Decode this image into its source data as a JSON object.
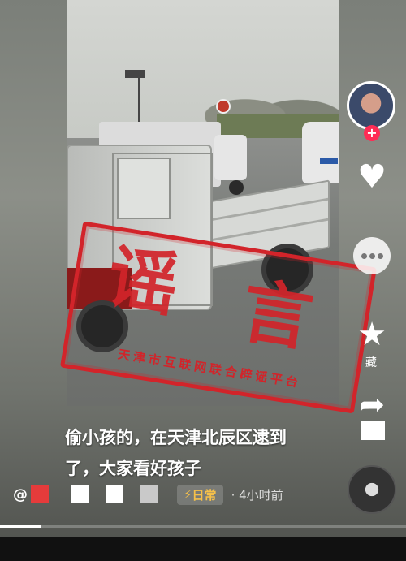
{
  "video": {
    "stamp_main": [
      "谣",
      "言"
    ],
    "stamp_subtitle": "天津市互联网联合辟谣平台"
  },
  "caption": {
    "line1": "偷小孩的，在天津北辰区逮到",
    "line2": "了，大家看好孩子"
  },
  "meta": {
    "at_symbol": "@",
    "tag_label": "日常",
    "time_ago": "· 4小时前"
  },
  "sidebar": {
    "follow": "+",
    "favorite_label": "藏"
  },
  "playback": {
    "progress": 0.1
  },
  "colors": {
    "stamp": "#d2242a",
    "tag": "#f5c04a",
    "follow": "#ff2c55"
  },
  "icons": [
    "heart-icon",
    "comment-icon",
    "star-icon",
    "share-icon",
    "lightning-icon"
  ]
}
